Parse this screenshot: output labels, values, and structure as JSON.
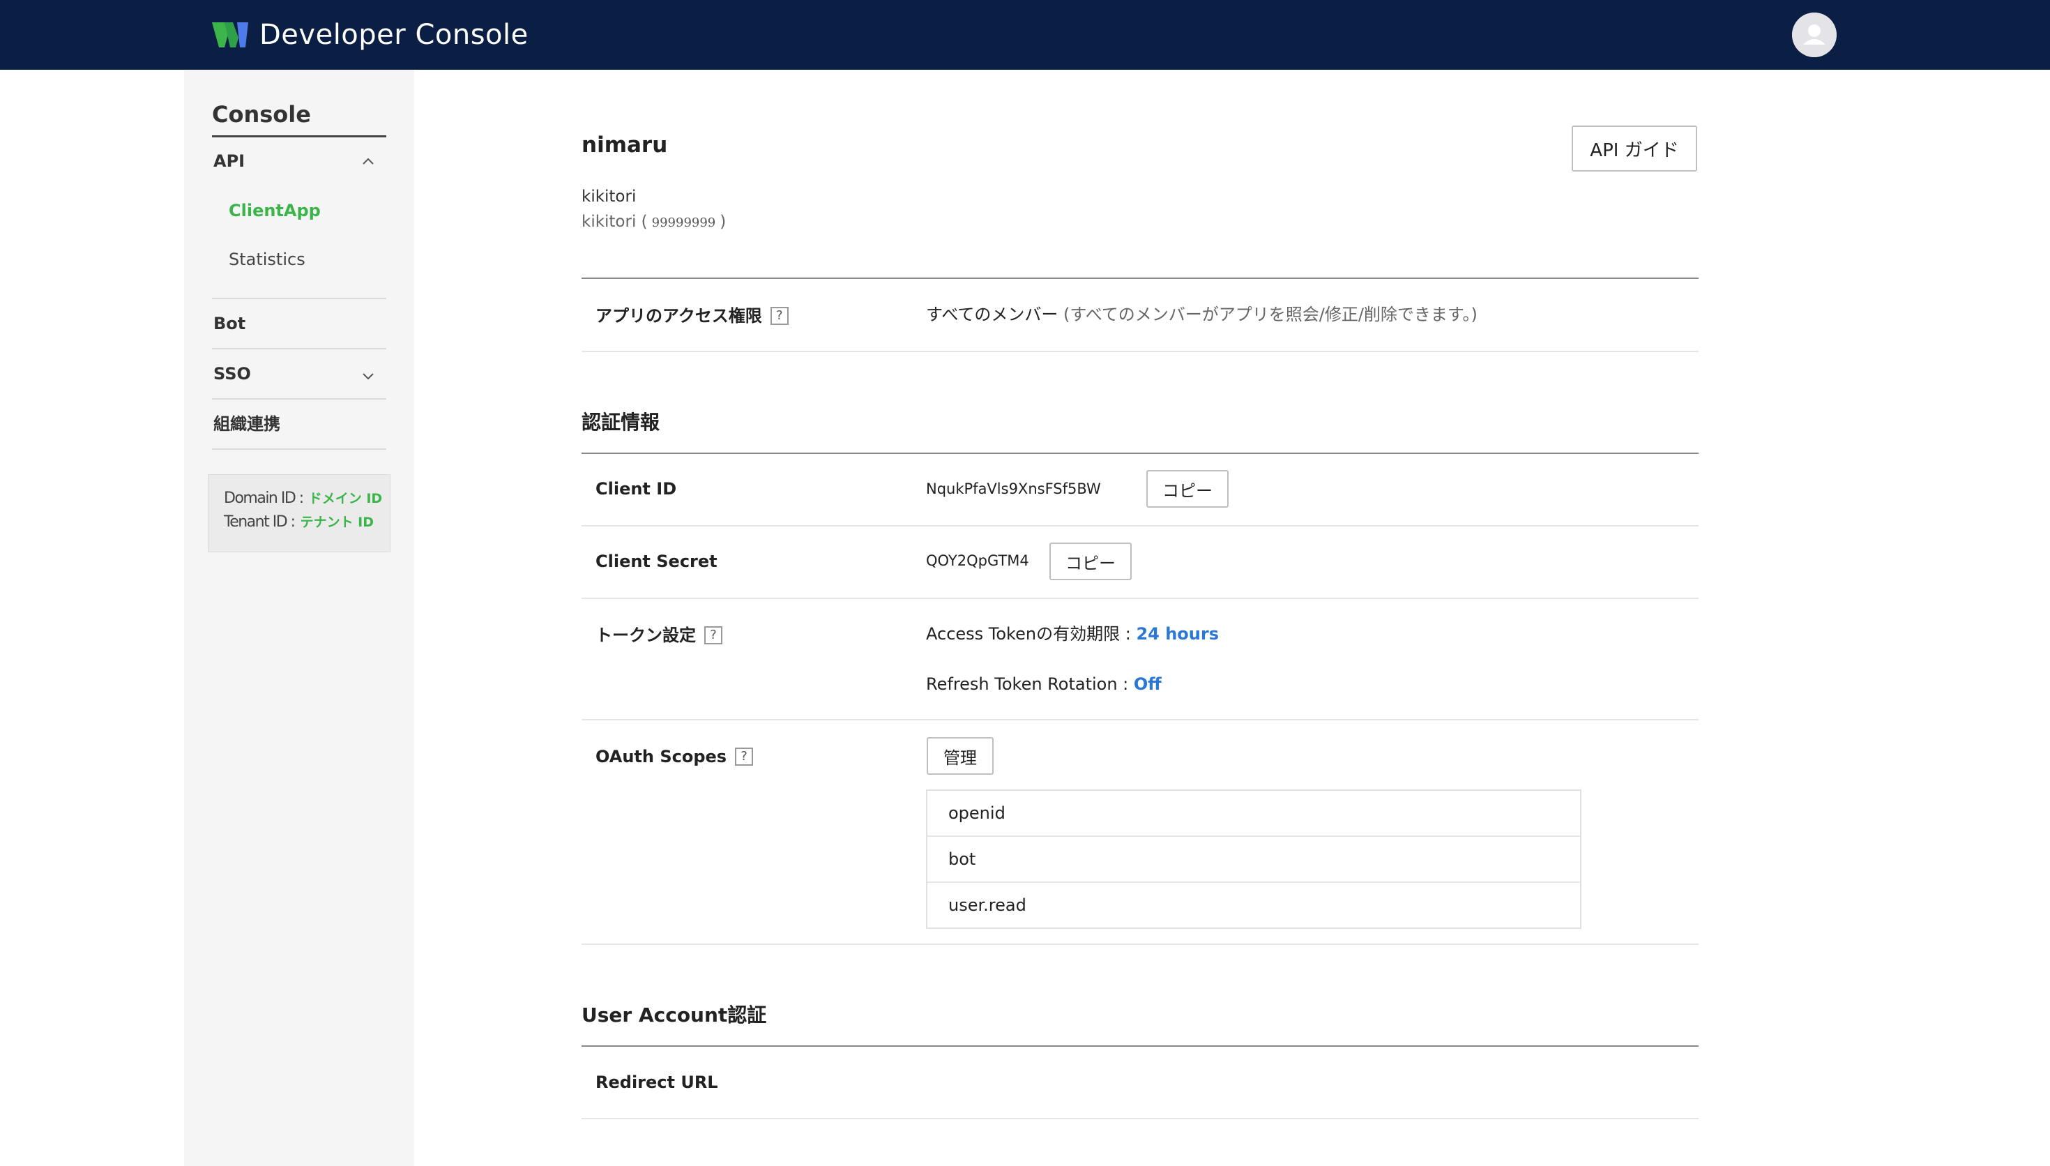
{
  "header": {
    "title": "Developer Console",
    "logo_icon": "w-logo-icon",
    "avatar_icon": "user-avatar-icon"
  },
  "sidebar": {
    "title": "Console",
    "items": [
      {
        "label": "API",
        "expanded": true,
        "subitems": [
          {
            "label": "ClientApp",
            "active": true
          },
          {
            "label": "Statistics",
            "active": false
          }
        ]
      },
      {
        "label": "Bot"
      },
      {
        "label": "SSO",
        "expanded": false
      },
      {
        "label": "組織連携"
      }
    ],
    "ids": {
      "domain_label": "Domain ID :",
      "domain_value": "ドメイン ID",
      "tenant_label": "Tenant ID :",
      "tenant_value": "テナント ID"
    }
  },
  "app": {
    "name": "nimaru",
    "guide_button": "API ガイド",
    "org_name": "kikitori",
    "org_sub_prefix": "kikitori (",
    "org_sub_number": "99999999",
    "org_sub_suffix": ")"
  },
  "access": {
    "label": "アプリのアクセス権限",
    "help": "?",
    "value": "すべてのメンバー",
    "description": "(すべてのメンバーがアプリを照会/修正/削除できます。)"
  },
  "auth": {
    "heading": "認証情報",
    "client_id_label": "Client ID",
    "client_id_value": "NqukPfaVls9XnsFSf5BW",
    "client_secret_label": "Client Secret",
    "client_secret_value": "QOY2QpGTM4",
    "copy_label": "コピー",
    "token_label": "トークン設定",
    "token_help": "?",
    "access_token_text": "Access Tokenの有効期限 :",
    "access_token_value": "24 hours",
    "refresh_text": "Refresh Token Rotation :",
    "refresh_value": "Off",
    "scopes_label": "OAuth Scopes",
    "scopes_help": "?",
    "manage_label": "管理",
    "scopes": [
      "openid",
      "bot",
      "user.read"
    ]
  },
  "user_auth": {
    "heading": "User Account認証",
    "redirect_label": "Redirect URL"
  },
  "colors": {
    "header_bg": "#0b1e44",
    "accent_green": "#3bb44a",
    "link_blue": "#2a78d6"
  }
}
